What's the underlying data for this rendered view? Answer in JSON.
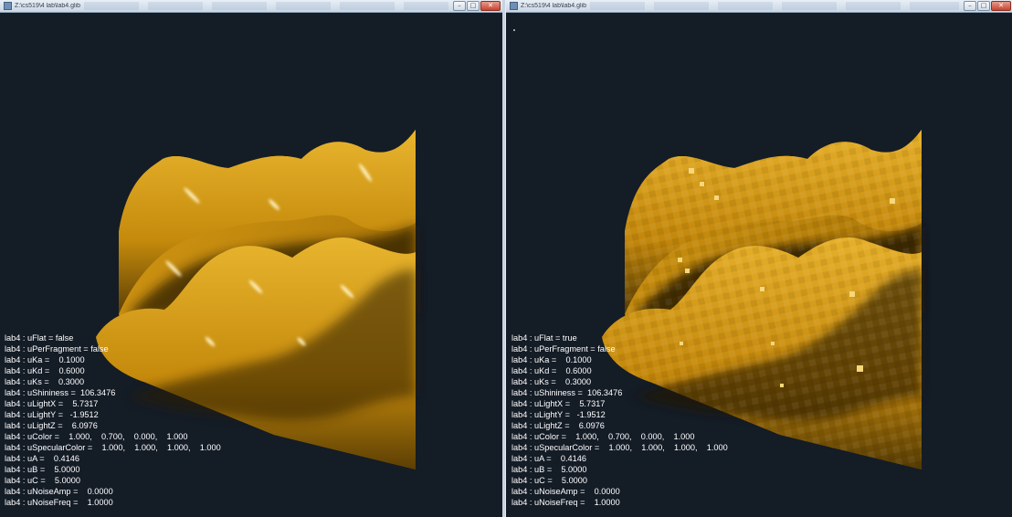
{
  "windows": [
    {
      "title": "Z:\\cs519\\4 lab\\lab4.glib",
      "shading": "smooth",
      "uniforms": [
        "lab4 : uFlat = false",
        "lab4 : uPerFragment = false",
        "lab4 : uKa =    0.1000",
        "lab4 : uKd =    0.6000",
        "lab4 : uKs =    0.3000",
        "lab4 : uShininess =  106.3476",
        "lab4 : uLightX =    5.7317",
        "lab4 : uLightY =   -1.9512",
        "lab4 : uLightZ =    6.0976",
        "lab4 : uColor =    1.000,    0.700,    0.000,    1.000",
        "lab4 : uSpecularColor =    1.000,    1.000,    1.000,    1.000",
        "lab4 : uA =    0.4146",
        "lab4 : uB =    5.0000",
        "lab4 : uC =    5.0000",
        "lab4 : uNoiseAmp =    0.0000",
        "lab4 : uNoiseFreq =    1.0000"
      ]
    },
    {
      "title": "Z:\\cs519\\4 lab\\lab4.glib",
      "shading": "flat",
      "uniforms": [
        "lab4 : uFlat = true",
        "lab4 : uPerFragment = false",
        "lab4 : uKa =    0.1000",
        "lab4 : uKd =    0.6000",
        "lab4 : uKs =    0.3000",
        "lab4 : uShininess =  106.3476",
        "lab4 : uLightX =    5.7317",
        "lab4 : uLightY =   -1.9512",
        "lab4 : uLightZ =    6.0976",
        "lab4 : uColor =    1.000,    0.700,    0.000,    1.000",
        "lab4 : uSpecularColor =    1.000,    1.000,    1.000,    1.000",
        "lab4 : uA =    0.4146",
        "lab4 : uB =    5.0000",
        "lab4 : uC =    5.0000",
        "lab4 : uNoiseAmp =    0.0000",
        "lab4 : uNoiseFreq =    1.0000"
      ]
    }
  ],
  "window_buttons": {
    "minimize": "–",
    "maximize": "□",
    "close": "✕"
  },
  "colors": {
    "background": "#141c26",
    "surface_base": "#c58a0c",
    "surface_light": "#e6b22a",
    "surface_dark": "#3a2903",
    "text": "#ffffff"
  },
  "icons": [
    "app-icon",
    "minimize-icon",
    "maximize-icon",
    "close-icon"
  ]
}
